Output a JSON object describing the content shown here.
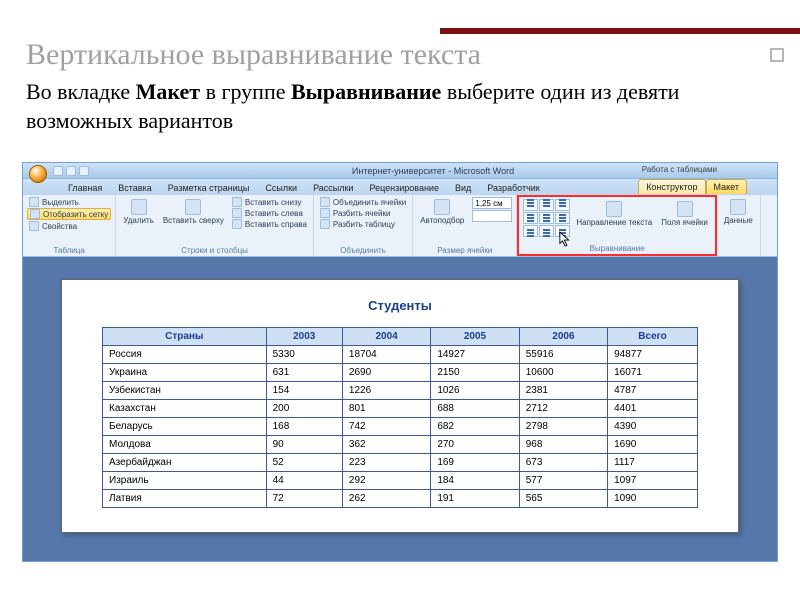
{
  "slide": {
    "title": "Вертикальное выравнивание текста",
    "body_part1": "Во вкладке ",
    "bold1": "Макет",
    "body_part2": " в группе ",
    "bold2": "Выравнивание",
    "body_part3": " выберите один из девяти возможных вариантов"
  },
  "word": {
    "docTitle": "Интернет-университет - Microsoft Word",
    "contextLabel": "Работа с таблицами",
    "tabs": {
      "home": "Главная",
      "insert": "Вставка",
      "pageLayout": "Разметка страницы",
      "references": "Ссылки",
      "mailings": "Рассылки",
      "review": "Рецензирование",
      "view": "Вид",
      "developer": "Разработчик",
      "design": "Конструктор",
      "layout": "Макет"
    },
    "ribbon": {
      "groupTable": "Таблица",
      "select": "Выделить",
      "showGrid": "Отобразить сетку",
      "properties": "Свойства",
      "groupRowsCols": "Строки и столбцы",
      "delete": "Удалить",
      "insertAbove": "Вставить сверху",
      "insertBelow": "Вставить снизу",
      "insertLeft": "Вставить слева",
      "insertRight": "Вставить справа",
      "groupMerge": "Объединить",
      "mergeCells": "Объединить ячейки",
      "splitCells": "Разбить ячейки",
      "splitTable": "Разбить таблицу",
      "groupCellSize": "Размер ячейки",
      "autofit": "Автоподбор",
      "height": "1,25 см",
      "width": " ",
      "groupAlign": "Выравнивание",
      "textDirection": "Направление текста",
      "cellMargins": "Поля ячейки",
      "groupData": "Данные"
    },
    "document": {
      "heading": "Студенты",
      "headers": [
        "Страны",
        "2003",
        "2004",
        "2005",
        "2006",
        "Всего"
      ],
      "rows": [
        [
          "Россия",
          "5330",
          "18704",
          "14927",
          "55916",
          "94877"
        ],
        [
          "Украина",
          "631",
          "2690",
          "2150",
          "10600",
          "16071"
        ],
        [
          "Узбекистан",
          "154",
          "1226",
          "1026",
          "2381",
          "4787"
        ],
        [
          "Казахстан",
          "200",
          "801",
          "688",
          "2712",
          "4401"
        ],
        [
          "Беларусь",
          "168",
          "742",
          "682",
          "2798",
          "4390"
        ],
        [
          "Молдова",
          "90",
          "362",
          "270",
          "968",
          "1690"
        ],
        [
          "Азербайджан",
          "52",
          "223",
          "169",
          "673",
          "1117"
        ],
        [
          "Израиль",
          "44",
          "292",
          "184",
          "577",
          "1097"
        ],
        [
          "Латвия",
          "72",
          "262",
          "191",
          "565",
          "1090"
        ]
      ]
    }
  }
}
